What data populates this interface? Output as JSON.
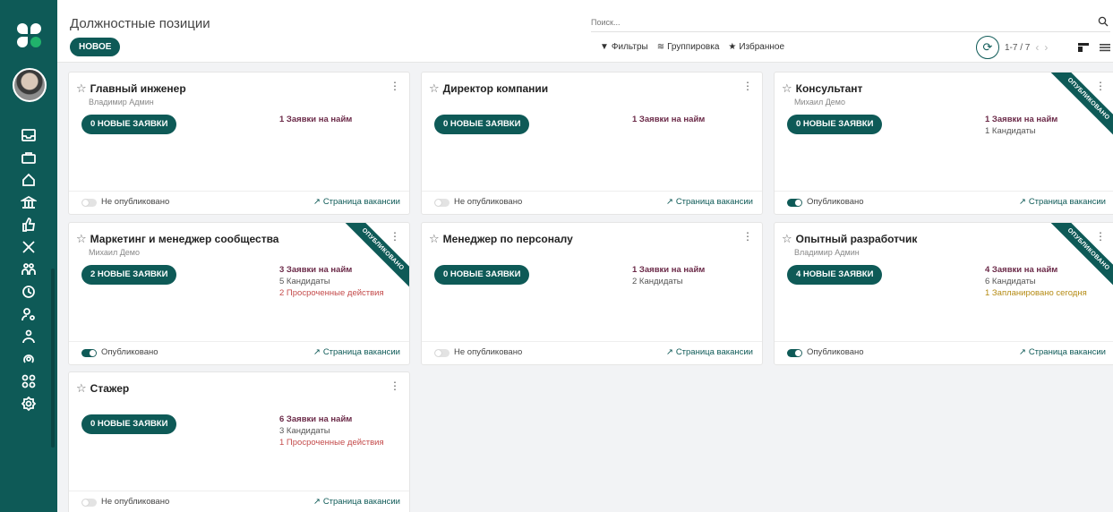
{
  "header": {
    "title": "Должностные позиции",
    "new_label": "НОВОЕ",
    "search_placeholder": "Поиск...",
    "filters": [
      "Фильтры",
      "Группировка",
      "Избранное"
    ],
    "pager": "1-7 / 7"
  },
  "sidebar": {
    "icons": [
      "inbox-icon",
      "briefcase-icon",
      "home-icon",
      "bank-icon",
      "thumbs-up-icon",
      "tools-icon",
      "people-icon",
      "clock-icon",
      "user-search-icon",
      "team-icon",
      "loop-icon",
      "apps-icon",
      "settings-icon"
    ]
  },
  "colors": {
    "brand": "#0e5a57",
    "request": "#6b2a48",
    "overdue": "#c44b4b",
    "planned": "#b58b14"
  },
  "cards": [
    {
      "title": "Главный инженер",
      "subtitle": "Владимир Админ",
      "button": "0 НОВЫЕ ЗАЯВКИ",
      "requests": "1 Заявки на найм",
      "candidates": "",
      "extra": "",
      "extra_type": "",
      "published": false,
      "status": "Не опубликовано",
      "link": "Страница вакансии",
      "ribbon": ""
    },
    {
      "title": "Директор компании",
      "subtitle": "",
      "button": "0 НОВЫЕ ЗАЯВКИ",
      "requests": "1 Заявки на найм",
      "candidates": "",
      "extra": "",
      "extra_type": "",
      "published": false,
      "status": "Не опубликовано",
      "link": "Страница вакансии",
      "ribbon": ""
    },
    {
      "title": "Консультант",
      "subtitle": "Михаил Демо",
      "button": "0 НОВЫЕ ЗАЯВКИ",
      "requests": "1 Заявки на найм",
      "candidates": "1 Кандидаты",
      "extra": "",
      "extra_type": "",
      "published": true,
      "status": "Опубликовано",
      "link": "Страница вакансии",
      "ribbon": "ОПУБЛИКОВАНО"
    },
    {
      "title": "Маркетинг и менеджер сообщества",
      "subtitle": "Михаил Демо",
      "button": "2 НОВЫЕ ЗАЯВКИ",
      "requests": "3 Заявки на найм",
      "candidates": "5 Кандидаты",
      "extra": "2 Просроченные действия",
      "extra_type": "overdue",
      "published": true,
      "status": "Опубликовано",
      "link": "Страница вакансии",
      "ribbon": "ОПУБЛИКОВАНО"
    },
    {
      "title": "Менеджер по персоналу",
      "subtitle": "",
      "button": "0 НОВЫЕ ЗАЯВКИ",
      "requests": "1 Заявки на найм",
      "candidates": "2 Кандидаты",
      "extra": "",
      "extra_type": "",
      "published": false,
      "status": "Не опубликовано",
      "link": "Страница вакансии",
      "ribbon": ""
    },
    {
      "title": "Опытный разработчик",
      "subtitle": "Владимир Админ",
      "button": "4 НОВЫЕ ЗАЯВКИ",
      "requests": "4 Заявки на найм",
      "candidates": "6 Кандидаты",
      "extra": "1 Запланировано сегодня",
      "extra_type": "planned",
      "published": true,
      "status": "Опубликовано",
      "link": "Страница вакансии",
      "ribbon": "ОПУБЛИКОВАНО"
    },
    {
      "title": "Стажер",
      "subtitle": "",
      "button": "0 НОВЫЕ ЗАЯВКИ",
      "requests": "6 Заявки на найм",
      "candidates": "3 Кандидаты",
      "extra": "1 Просроченные действия",
      "extra_type": "overdue",
      "published": false,
      "status": "Не опубликовано",
      "link": "Страница вакансии",
      "ribbon": ""
    }
  ]
}
